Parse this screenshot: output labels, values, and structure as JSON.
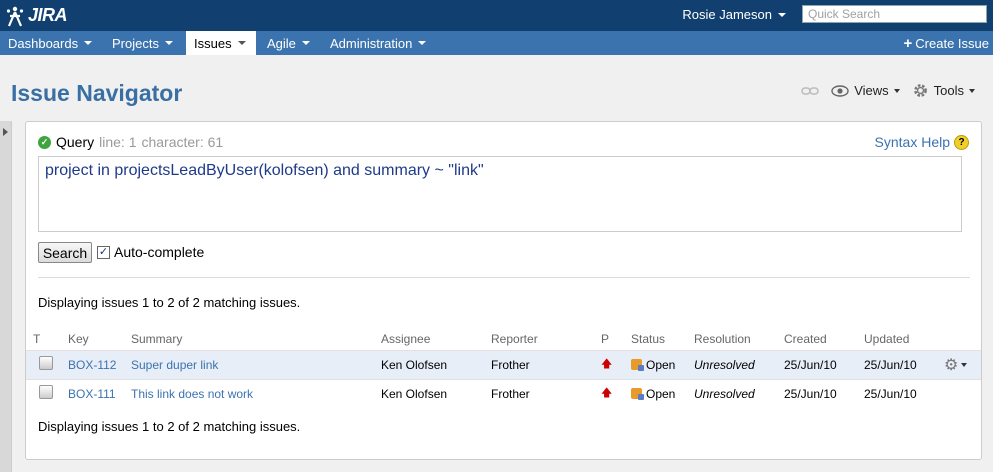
{
  "header": {
    "logo_text": "JIRA",
    "user_name": "Rosie Jameson",
    "quick_search_placeholder": "Quick Search"
  },
  "nav": {
    "items": [
      {
        "label": "Dashboards"
      },
      {
        "label": "Projects"
      },
      {
        "label": "Issues",
        "active": true
      },
      {
        "label": "Agile"
      },
      {
        "label": "Administration"
      }
    ],
    "create_issue": "Create Issue"
  },
  "page": {
    "title": "Issue Navigator",
    "views_label": "Views",
    "tools_label": "Tools"
  },
  "query": {
    "label": "Query",
    "line_info": "line: 1",
    "char_info": "character: 61",
    "syntax_help": "Syntax Help",
    "text": "project in projectsLeadByUser(kolofsen) and summary ~ \"link\"",
    "search_button": "Search",
    "autocomplete_label": "Auto-complete",
    "autocomplete_checked": true
  },
  "results": {
    "message_top": "Displaying issues 1 to 2 of 2 matching issues.",
    "message_bottom": "Displaying issues 1 to 2 of 2 matching issues.",
    "columns": [
      "T",
      "Key",
      "Summary",
      "Assignee",
      "Reporter",
      "P",
      "Status",
      "Resolution",
      "Created",
      "Updated"
    ],
    "rows": [
      {
        "key": "BOX-112",
        "summary": "Super duper link",
        "assignee": "Ken Olofsen",
        "reporter": "Frother",
        "status": "Open",
        "resolution": "Unresolved",
        "created": "25/Jun/10",
        "updated": "25/Jun/10"
      },
      {
        "key": "BOX-111",
        "summary": "This link does not work",
        "assignee": "Ken Olofsen",
        "reporter": "Frother",
        "status": "Open",
        "resolution": "Unresolved",
        "created": "25/Jun/10",
        "updated": "25/Jun/10"
      }
    ]
  },
  "colors": {
    "header_bg": "#114070",
    "nav_bg": "#3b73af",
    "title": "#3a6fa3",
    "link": "#3b73af",
    "highlight_row": "#e8eef8"
  }
}
